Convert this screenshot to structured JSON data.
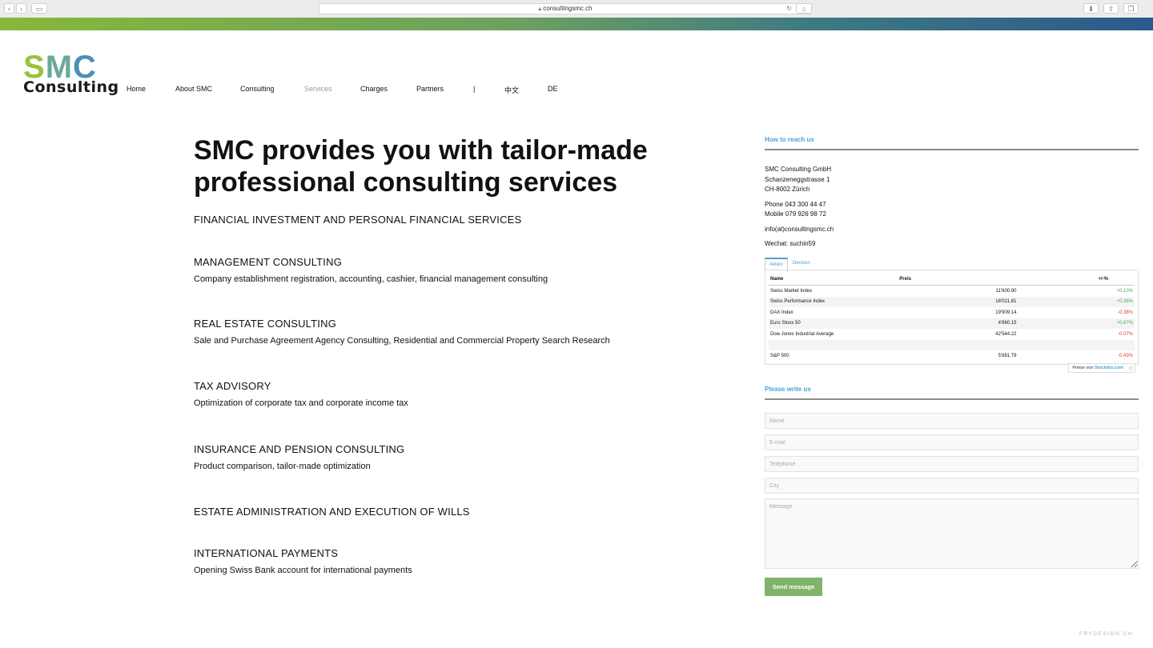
{
  "browser": {
    "url": "consultingsmc.ch",
    "back_icon": "chevron-left-icon",
    "forward_icon": "chevron-right-icon"
  },
  "brand": {
    "logo_s": "S",
    "logo_m": "M",
    "logo_c": "C",
    "logo_sub": "Consulting",
    "colors": {
      "s": "#9bc23c",
      "m": "#6aa99a",
      "c": "#4a8fb8",
      "accent": "#4a9fd8",
      "button": "#7fb46a"
    }
  },
  "nav": {
    "items": [
      "Home",
      "About SMC",
      "Consulting",
      "Services",
      "Charges",
      "Partners",
      "|",
      "中文",
      "DE"
    ],
    "active": "Services"
  },
  "main": {
    "headline_line1": "SMC provides you with tailor-made",
    "headline_line2": "professional consulting services",
    "services": [
      {
        "title": "FINANCIAL INVESTMENT AND PERSONAL FINANCIAL SERVICES",
        "desc": ""
      },
      {
        "title": "MANAGEMENT CONSULTING",
        "desc": "Company establishment registration, accounting, cashier, financial management consulting"
      },
      {
        "title": "REAL ESTATE CONSULTING",
        "desc": "Sale and Purchase Agreement Agency Consulting, Residential and Commercial Property Search Research"
      },
      {
        "title": "TAX ADVISORY",
        "desc": "Optimization of corporate tax and corporate income tax"
      },
      {
        "title": "INSURANCE AND PENSION CONSULTING",
        "desc": "Product comparison, tailor-made optimization"
      },
      {
        "title": "ESTATE ADMINISTRATION AND EXECUTION OF WILLS",
        "desc": ""
      },
      {
        "title": "INTERNATIONAL PAYMENTS",
        "desc": "Opening Swiss Bank account for international payments"
      }
    ]
  },
  "sidebar": {
    "reach_title": "How to reach us",
    "company": "SMC Consulting GmbH",
    "street": "Schanzeneggstrasse 1",
    "city": "CH-8002 Zürich",
    "phone": "Phone 043 300 44 47",
    "mobile": "Mobile 079 926 98 72",
    "email": "info(at)consultingsmc.ch",
    "wechat": "Wechat: suchin59",
    "widget": {
      "tab_active": "Aktien",
      "tab_inactive": "Devisen",
      "col_name": "Name",
      "col_price": "Preis",
      "col_change": "+/-%",
      "rows": [
        {
          "name": "Swiss Market Index",
          "price": "11'600.90",
          "change": "+0.10%",
          "dir": "pos"
        },
        {
          "name": "Swiss Performance Index",
          "price": "16'021.81",
          "change": "+0.36%",
          "dir": "pos"
        },
        {
          "name": "DAX Index",
          "price": "19'909.14",
          "change": "-0.38%",
          "dir": "neg"
        },
        {
          "name": "Euro Stoxx 50",
          "price": "4'860.15",
          "change": "+0.67%",
          "dir": "pos"
        },
        {
          "name": "Dow Jones Industrial Average",
          "price": "42'544.22",
          "change": "-0.07%",
          "dir": "neg"
        },
        {
          "name": "",
          "price": "",
          "change": "",
          "dir": ""
        },
        {
          "name": "S&P 500",
          "price": "5'881.79",
          "change": "-0.43%",
          "dir": "neg"
        }
      ],
      "credit_prefix": "Preise von",
      "credit_brand": "Stockdio.com"
    },
    "write_title": "Please write us",
    "form": {
      "name_placeholder": "Name",
      "email_placeholder": "E-mail",
      "phone_placeholder": "Telephone",
      "city_placeholder": "City",
      "message_placeholder": "Message",
      "send_label": "Send message"
    }
  },
  "footer": {
    "credit": "FRYDESIGN.CH"
  }
}
